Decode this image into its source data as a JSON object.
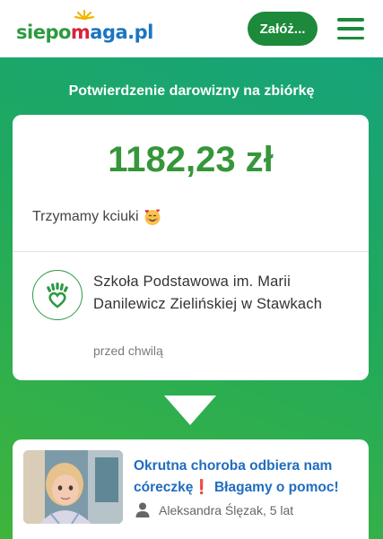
{
  "header": {
    "logo": {
      "part1": "siepo",
      "part2": "m",
      "part3": "aga",
      "part4": ".pl"
    },
    "cta_label": "Załóż...",
    "menu_icon": "hamburger-icon"
  },
  "hero": {
    "title": "Potwierdzenie darowizny na zbiórkę"
  },
  "donation": {
    "amount": "1182,23 zł",
    "message": "Trzymamy kciuki",
    "message_emoji": "smiling-face-with-hearts-emoji",
    "donor_icon": "hands-heart-icon",
    "donor_name": "Szkoła Podstawowa im. Marii Danilewicz Zielińskiej w Stawkach",
    "time_ago": "przed chwilą"
  },
  "fundraiser": {
    "title_part1": "Okrutna choroba odbiera nam córeczkę",
    "exclamation": "❗",
    "title_part2": " Błagamy o pomoc!",
    "person_icon": "person-icon",
    "beneficiary": "Aleksandra Ślęzak, 5 lat"
  },
  "colors": {
    "brand_green": "#1c8a3a",
    "amount_green": "#36963a",
    "link_blue": "#1f6cc0",
    "accent_red": "#d8233c"
  }
}
